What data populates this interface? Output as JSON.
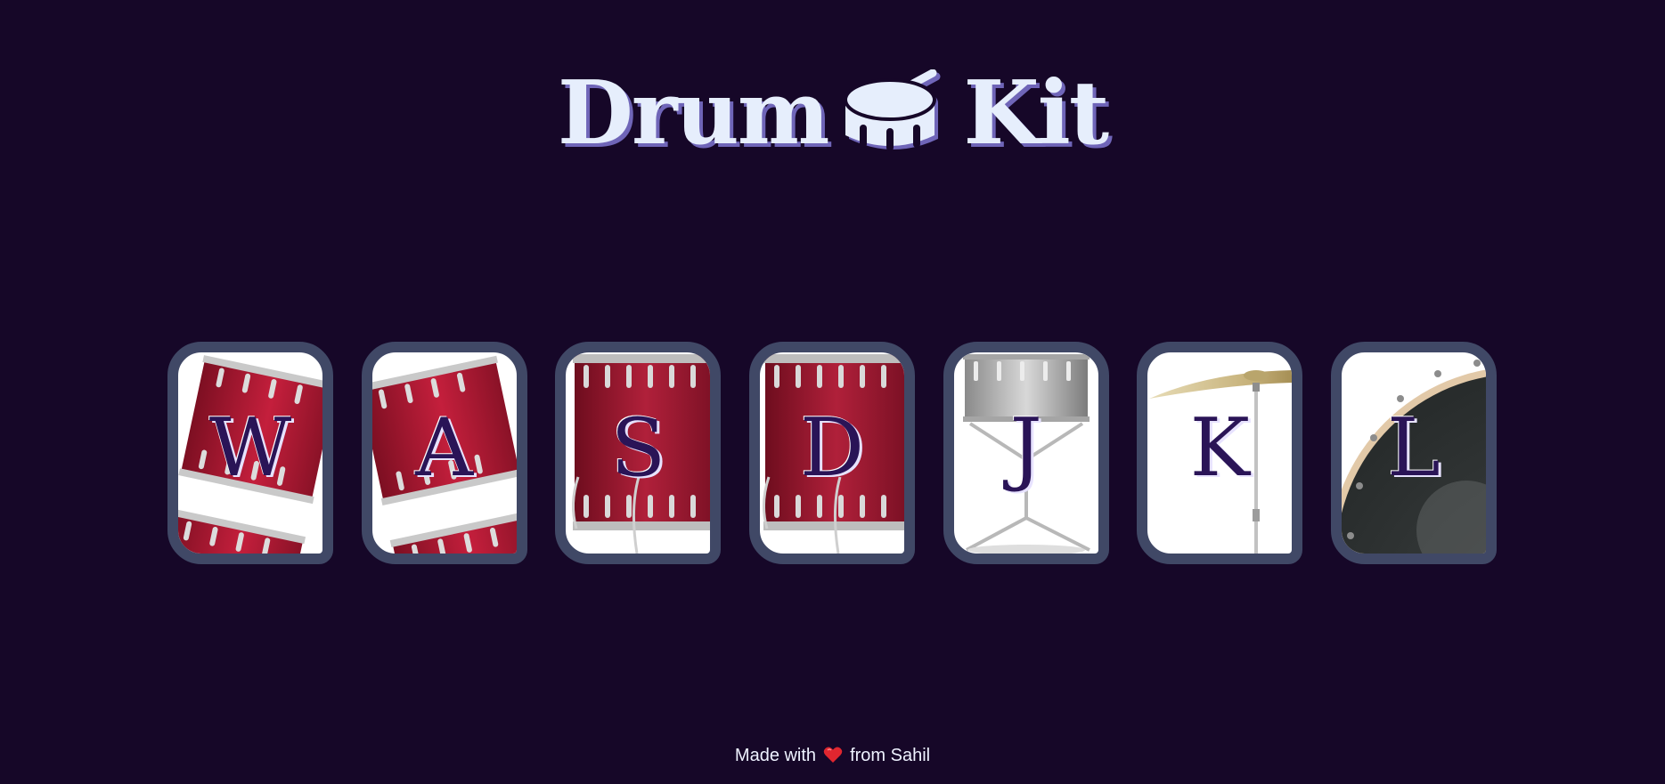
{
  "header": {
    "title_left": "Drum",
    "title_icon": "drum-icon",
    "title_right": "Kit"
  },
  "keys": [
    {
      "letter": "W",
      "sound_icon": "tom-drum-icon"
    },
    {
      "letter": "A",
      "sound_icon": "tom-drum-icon"
    },
    {
      "letter": "S",
      "sound_icon": "snare-drum-icon"
    },
    {
      "letter": "D",
      "sound_icon": "snare-drum-icon"
    },
    {
      "letter": "J",
      "sound_icon": "silver-snare-stand-icon"
    },
    {
      "letter": "K",
      "sound_icon": "cymbal-icon"
    },
    {
      "letter": "L",
      "sound_icon": "bass-drum-icon"
    }
  ],
  "footer": {
    "made_with": "Made with",
    "heart_icon": "heart-icon",
    "from": "from Sahil"
  },
  "colors": {
    "background": "#160728",
    "title": "#e6eefc",
    "title_shadow": "#6f65b8",
    "key_border": "#404866",
    "letter": "#2a1457",
    "drum_red": "#a3142f",
    "heart": "#e0262f"
  }
}
